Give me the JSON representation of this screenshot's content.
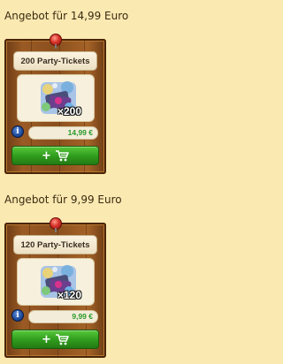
{
  "offers": [
    {
      "heading": "Angebot für 14,99 Euro",
      "title": "200 Party-Tickets",
      "quantity": "×200",
      "price": "14,99 €",
      "info_glyph": "i",
      "buy_plus": "+",
      "icons": [
        "pin-icon",
        "party-tickets-icon",
        "info-icon",
        "plus-icon",
        "shopping-cart-icon"
      ]
    },
    {
      "heading": "Angebot für 9,99 Euro",
      "title": "120 Party-Tickets",
      "quantity": "×120",
      "price": "9,99 €",
      "info_glyph": "i",
      "buy_plus": "+",
      "icons": [
        "pin-icon",
        "party-tickets-icon",
        "info-icon",
        "plus-icon",
        "shopping-cart-icon"
      ]
    }
  ],
  "colors": {
    "page_background": "#fbe9b2",
    "price_text": "#2a9a2a",
    "buy_button": "#2f9b1d",
    "wood": "#8a4f1e"
  }
}
